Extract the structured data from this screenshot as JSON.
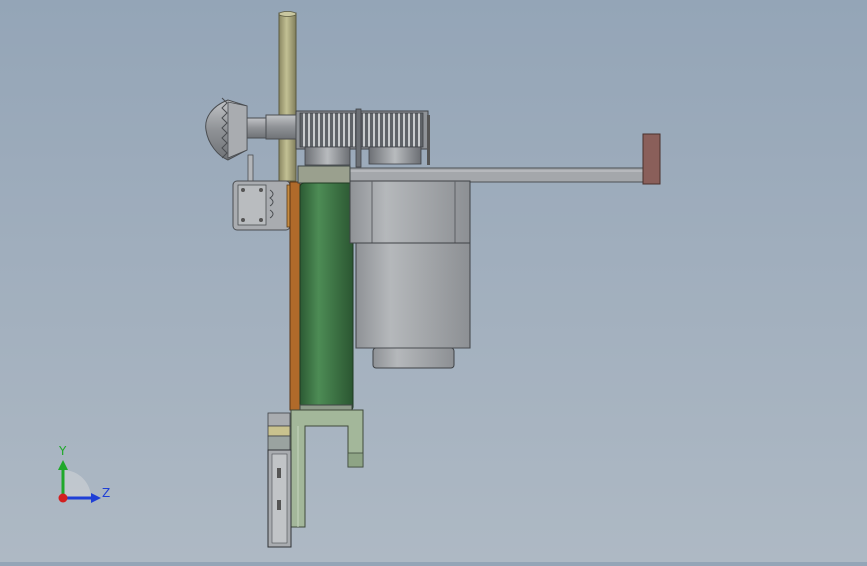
{
  "viewport": {
    "name": "cad-3d-viewport",
    "background_top": "#94a5b7",
    "background_bottom": "#aeb9c4"
  },
  "triad": {
    "y_label": "Y",
    "z_label": "Z",
    "y_color": "#1fa82a",
    "z_color": "#1f3fd6",
    "x_color": "#d21f1f"
  },
  "colors": {
    "rod": "#a6a47a",
    "roller": "#3f7a46",
    "motor_body": "#a9acaf",
    "gear": "#8e9297",
    "bracket_green": "#a3b79a",
    "orange_strip": "#b06a2a",
    "end_cap": "#8a5f5a",
    "knob": "#9a9da1"
  }
}
